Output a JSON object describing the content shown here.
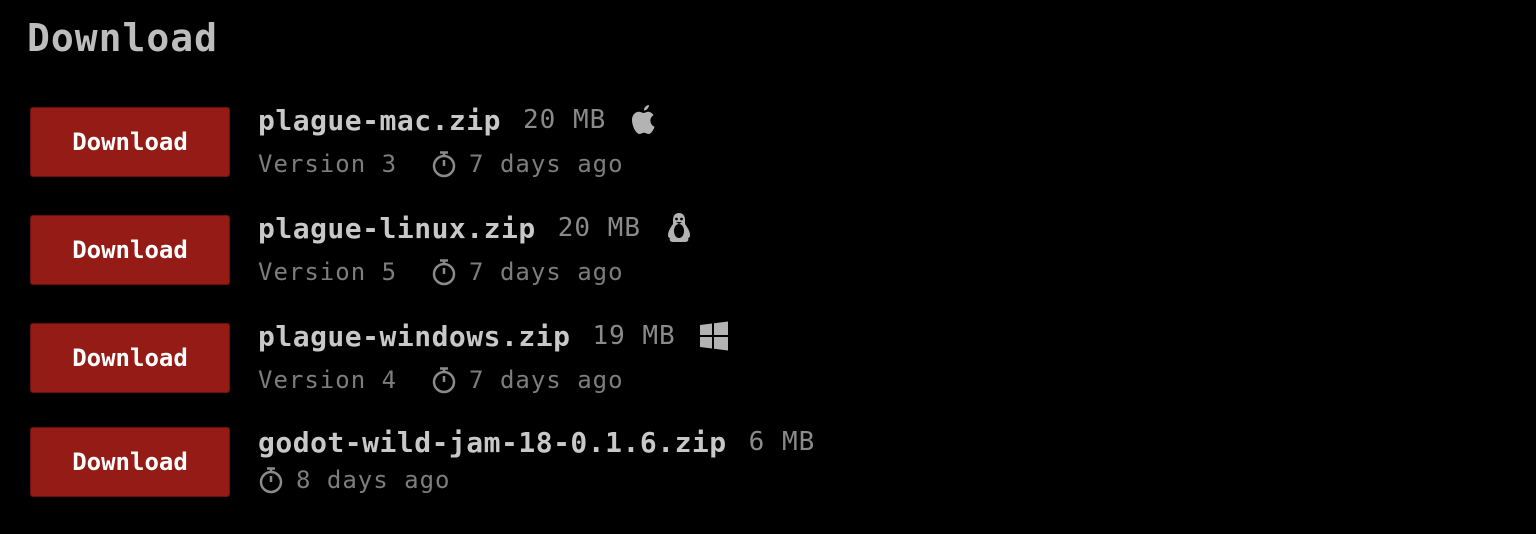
{
  "section": {
    "title": "Download"
  },
  "uploads": [
    {
      "button_label": "Download",
      "filename": "plague-mac.zip",
      "size": "20 MB",
      "os_icon": "apple-icon",
      "version": "Version 3",
      "age": "7 days ago"
    },
    {
      "button_label": "Download",
      "filename": "plague-linux.zip",
      "size": "20 MB",
      "os_icon": "linux-icon",
      "version": "Version 5",
      "age": "7 days ago"
    },
    {
      "button_label": "Download",
      "filename": "plague-windows.zip",
      "size": "19 MB",
      "os_icon": "windows-icon",
      "version": "Version 4",
      "age": "7 days ago"
    },
    {
      "button_label": "Download",
      "filename": "godot-wild-jam-18-0.1.6.zip",
      "size": "6 MB",
      "os_icon": "",
      "version": "",
      "age": "8 days ago"
    }
  ],
  "colors": {
    "background": "#000000",
    "button": "#941b16",
    "button_text": "#ffffff",
    "filename": "#c8c8c8",
    "muted": "#7d7d7d"
  }
}
